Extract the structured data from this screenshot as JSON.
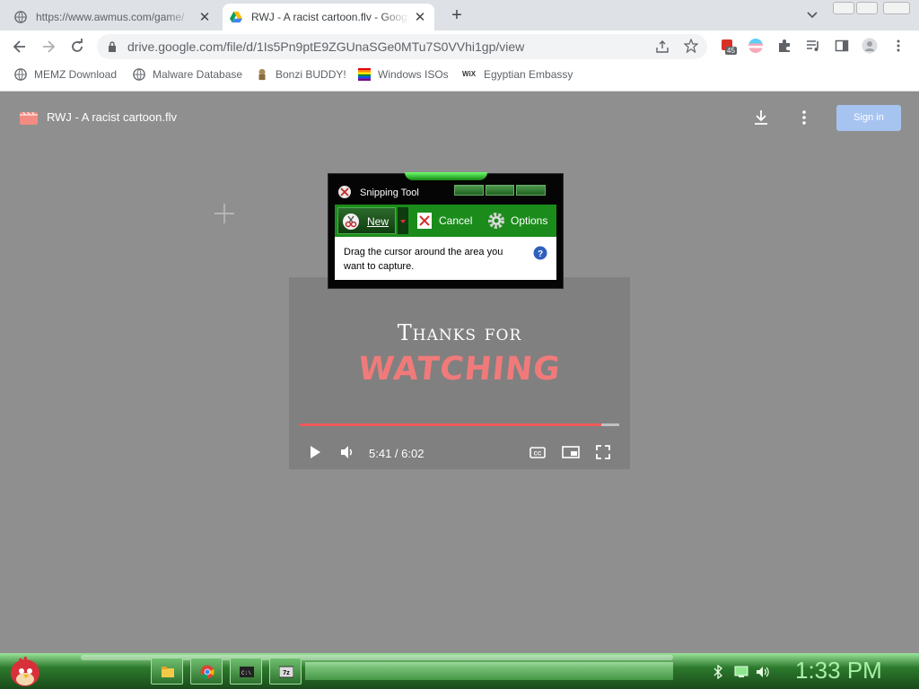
{
  "tabs": [
    {
      "title": "https://www.awmus.com/game/",
      "active": false,
      "favicon": "globe-icon"
    },
    {
      "title": "RWJ - A racist cartoon.flv - Google Drive",
      "active": true,
      "favicon": "google-drive-icon"
    }
  ],
  "omnibox": {
    "url": "drive.google.com/file/d/1Is5Pn9ptE9ZGUnaSGe0MTu7S0VVhi1gp/view"
  },
  "extensions": {
    "badge": "45"
  },
  "bookmarks": [
    {
      "label": "MEMZ Download",
      "icon": "globe-icon"
    },
    {
      "label": "Malware Database",
      "icon": "globe-icon"
    },
    {
      "label": "Bonzi BUDDY!",
      "icon": "bonzi-icon"
    },
    {
      "label": "Windows ISOs",
      "icon": "windows-flag-icon"
    },
    {
      "label": "Egyptian Embassy",
      "icon": "wix-icon"
    }
  ],
  "viewer": {
    "file_title": "RWJ - A racist cartoon.flv",
    "sign_in": "Sign in"
  },
  "video": {
    "line1": "Thanks for",
    "line2": "WATCHING",
    "time": "5:41 / 6:02",
    "progress_fraction": 0.945
  },
  "snipping_tool": {
    "title": "Snipping Tool",
    "new_label": "New",
    "cancel_label": "Cancel",
    "options_label": "Options",
    "message": "Drag the cursor around the area you want to capture."
  },
  "taskbar": {
    "clock": "1:33 PM",
    "apps": [
      "file-explorer-icon",
      "chrome-icon",
      "command-prompt-icon",
      "7zip-icon"
    ]
  },
  "colors": {
    "snip_green": "#1b8c1b",
    "taskbar_green": "#2d7a2d",
    "progress_red": "#f05959",
    "sign_in_blue": "#a7c4f1"
  }
}
